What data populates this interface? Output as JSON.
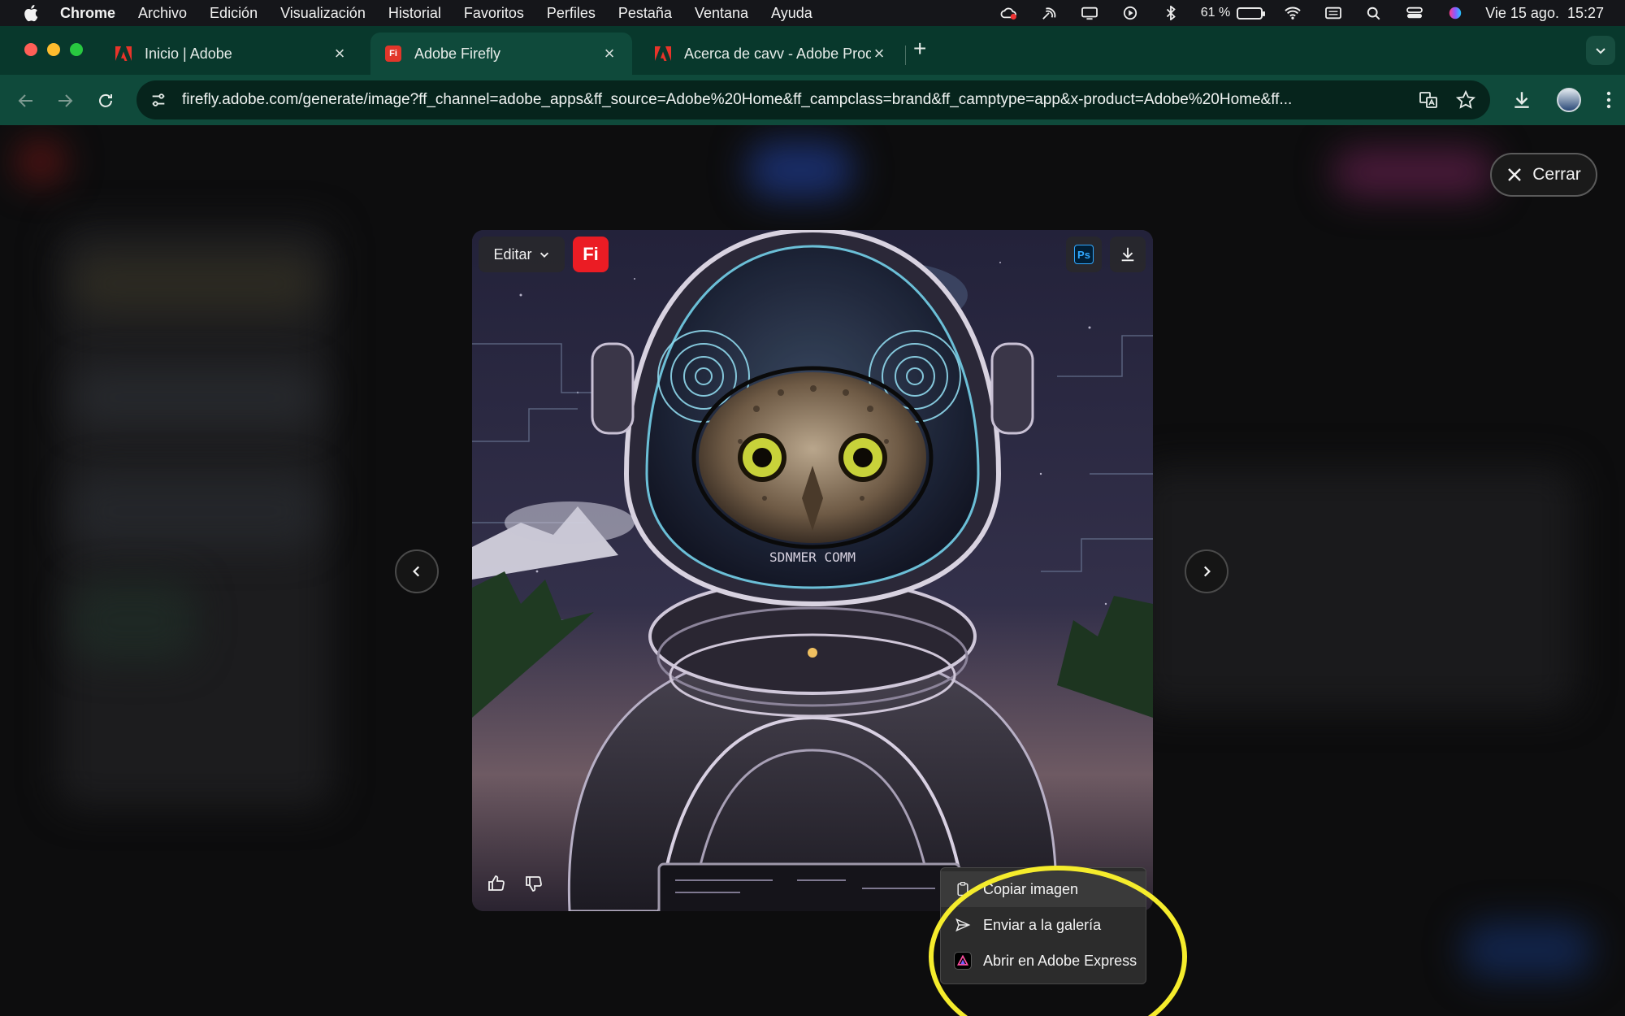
{
  "menubar": {
    "app_name": "Chrome",
    "items": [
      "Archivo",
      "Edición",
      "Visualización",
      "Historial",
      "Favoritos",
      "Perfiles",
      "Pestaña",
      "Ventana",
      "Ayuda"
    ],
    "battery_percent": "61 %",
    "battery_level": 0.61,
    "datetime": "Vie 15 ago.  15:27"
  },
  "tabs": [
    {
      "title": "Inicio | Adobe",
      "favicon": "adobe-icon",
      "active": false
    },
    {
      "title": "Adobe Firefly",
      "favicon": "firefly-icon",
      "active": true
    },
    {
      "title": "Acerca de cavv - Adobe Prod",
      "favicon": "adobe-icon",
      "active": false
    }
  ],
  "firefly_fav_text": "Fi",
  "address_bar": {
    "url": "firefly.adobe.com/generate/image?ff_channel=adobe_apps&ff_source=Adobe%20Home&ff_campclass=brand&ff_camptype=app&x-product=Adobe%20Home&ff..."
  },
  "viewer": {
    "close_label": "Cerrar",
    "edit_label": "Editar",
    "fi_badge": "Fi",
    "ps_badge": "Ps",
    "helmet_text": "SDNMER COMM"
  },
  "context_menu": {
    "items": [
      {
        "label": "Copiar imagen",
        "icon": "clipboard-icon"
      },
      {
        "label": "Enviar a la galería",
        "icon": "send-icon"
      },
      {
        "label": "Abrir en Adobe Express",
        "icon": "adobe-express-icon"
      }
    ]
  },
  "colors": {
    "chrome_tabstrip": "#08382c",
    "chrome_toolbar": "#0f4a3b",
    "highlight": "#f5ec2c",
    "firefly_red": "#eb1c24"
  }
}
